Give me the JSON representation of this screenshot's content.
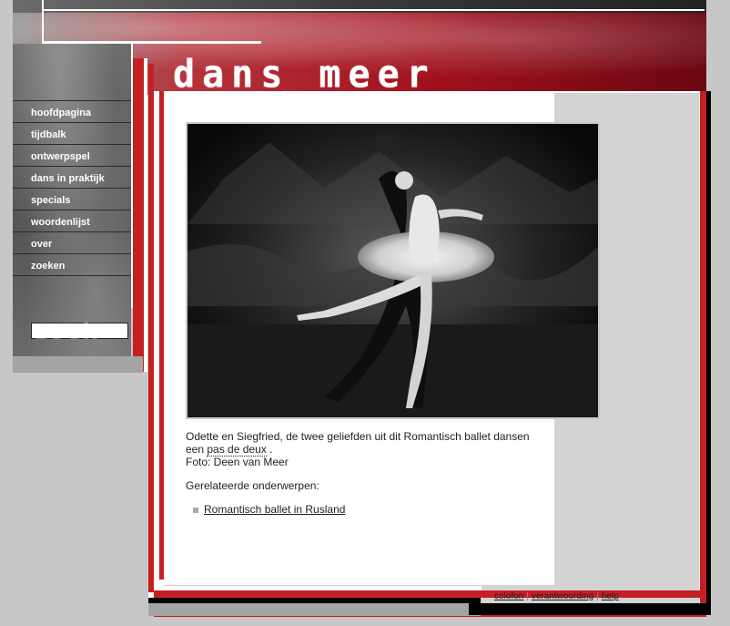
{
  "header": {
    "logo_text": "dans meer"
  },
  "nav": {
    "items": [
      {
        "label": "hoofdpagina"
      },
      {
        "label": "tijdbalk"
      },
      {
        "label": "ontwerpspel"
      },
      {
        "label": "dans in praktijk"
      },
      {
        "label": "specials"
      },
      {
        "label": "woordenlijst"
      },
      {
        "label": "over"
      },
      {
        "label": "zoeken"
      }
    ],
    "search_deco": "zoek"
  },
  "main": {
    "caption_line1": "Odette en Siegfried, de twee geliefden uit dit Romantisch ballet dansen een",
    "caption_link": "pas de deux",
    "caption_after_link": ".",
    "caption_credit": "Foto: Deen van Meer",
    "related_title": "Gerelateerde onderwerpen:",
    "related_links": [
      {
        "label": "Romantisch ballet in Rusland"
      }
    ]
  },
  "footer": {
    "links": [
      {
        "label": "colofon"
      },
      {
        "label": "verantwoording"
      },
      {
        "label": "help"
      }
    ],
    "separator": "|"
  },
  "colors": {
    "accent_red": "#c51f24",
    "frame_black": "#000000",
    "background_grey": "#c7c7c7"
  }
}
